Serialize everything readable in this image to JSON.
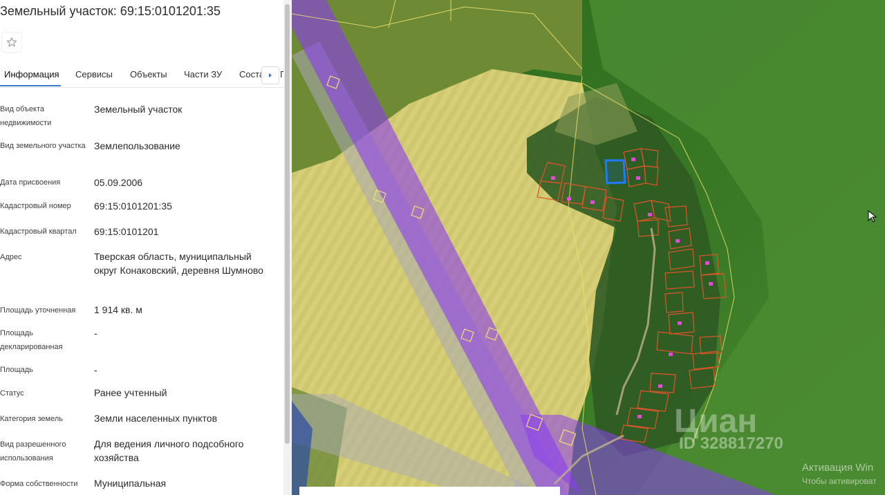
{
  "header": {
    "title": "Земельный участок: 69:15:0101201:35"
  },
  "tabs": [
    {
      "label": "Информация"
    },
    {
      "label": "Сервисы"
    },
    {
      "label": "Объекты"
    },
    {
      "label": "Части ЗУ"
    },
    {
      "label": "Соста"
    }
  ],
  "tab_overflow_glyph": "Г",
  "rows": [
    {
      "label": "Вид объекта недвижимости",
      "value": "Земельный участок"
    },
    {
      "label": "Вид земельного участка",
      "value": "Землепользование"
    },
    {
      "label": "Дата присвоения",
      "value": "05.09.2006"
    },
    {
      "label": "Кадастровый номер",
      "value": "69:15:0101201:35"
    },
    {
      "label": "Кадастровый квартал",
      "value": "69:15:0101201"
    },
    {
      "label": "Адрес",
      "value": "Тверская область, муниципальный округ Конаковский, деревня Шумново"
    },
    {
      "label": "Площадь уточненная",
      "value": "1 914 кв. м"
    },
    {
      "label": "Площадь декларированная",
      "value": "-"
    },
    {
      "label": "Площадь",
      "value": "-"
    },
    {
      "label": "Статус",
      "value": "Ранее учтенный"
    },
    {
      "label": "Категория земель",
      "value": "Земли населенных пунктов"
    },
    {
      "label": "Вид разрешенного использования",
      "value": "Для ведения личного подсобного хозяйства"
    },
    {
      "label": "Форма собственности",
      "value": "Муниципальная"
    }
  ],
  "map": {
    "watermark_text": "Циан",
    "watermark_id": "ID 328817270",
    "colors": {
      "selected_parcel": "#1e7bff",
      "parcel_outline": "#e0552a",
      "zone_fill": "#8a3cf0",
      "field": "#d8cf78",
      "forest": "#2f6a1f"
    }
  },
  "os_watermark": {
    "title": "Активация Win",
    "subtitle": "Чтобы активироват"
  }
}
